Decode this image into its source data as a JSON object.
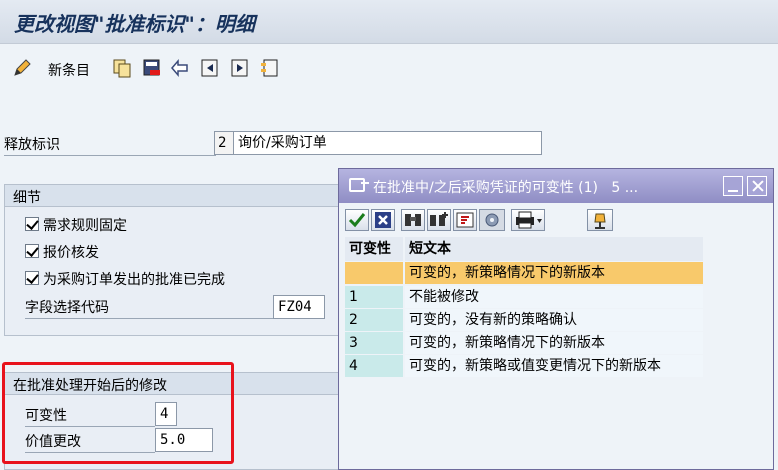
{
  "window": {
    "title": "更改视图\"批准标识\"：明细"
  },
  "toolbar": {
    "new_entries": "新条目"
  },
  "release_indicator": {
    "label": "释放标识",
    "code": "2",
    "description": "询价/采购订单"
  },
  "details": {
    "title": "细节",
    "checkbox_requirements_fixed": "需求规则固定",
    "checkbox_rfq_release": "报价核发",
    "checkbox_po_release_complete": "为采购订单发出的批准已完成",
    "field_selection_label": "字段选择代码",
    "field_selection_value": "FZ04"
  },
  "changes_section": {
    "title": "在批准处理开始后的修改",
    "changeability_label": "可变性",
    "changeability_value": "4",
    "value_change_label": "价值更改",
    "value_change_value": "5.0"
  },
  "popup": {
    "title": "在批准中/之后采购凭证的可变性 (1)",
    "title_suffix": "5 ...",
    "columns": {
      "key": "可变性",
      "text": "短文本"
    },
    "rows": [
      {
        "key": "",
        "text": "可变的，新策略情况下的新版本"
      },
      {
        "key": "1",
        "text": "不能被修改"
      },
      {
        "key": "2",
        "text": "可变的，没有新的策略确认"
      },
      {
        "key": "3",
        "text": "可变的，新策略情况下的新版本"
      },
      {
        "key": "4",
        "text": "可变的，新策略或值变更情况下的新版本"
      }
    ]
  },
  "colors": {
    "highlight_border": "#e8121c",
    "selected_row": "#f8c96b",
    "popup_title_bar": "#8f8dc4"
  }
}
